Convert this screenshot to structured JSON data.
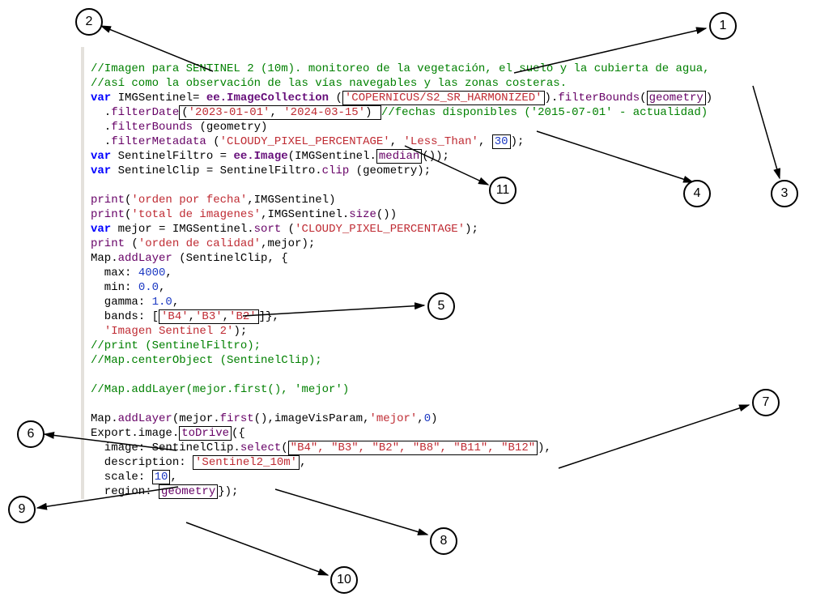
{
  "callouts": {
    "n1": "1",
    "n2": "2",
    "n3": "3",
    "n4": "4",
    "n5": "5",
    "n6": "6",
    "n7": "7",
    "n8": "8",
    "n9": "9",
    "n10": "10",
    "n11": "11"
  },
  "code": {
    "l1": "//Imagen para SENTINEL 2 (10m). monitoreo de la vegetación, el suelo y la cubierta de agua,",
    "l2": "//así como la observación de las vías navegables y las zonas costeras.",
    "l3_a": "var",
    "l3_b": " IMGSentinel= ",
    "l3_c": "ee.ImageCollection",
    "l3_d": " (",
    "l3_e": "'COPERNICUS/S2_SR_HARMONIZED'",
    "l3_f": ").",
    "l3_g": "filterBounds",
    "l3_h": "(",
    "l3_i": "geometry",
    "l3_j": ")",
    "l4_a": "  .",
    "l4_b": "filterDate",
    "l4_c": "(",
    "l4_d": "'2023-01-01'",
    "l4_e": ", ",
    "l4_f": "'2024-03-15'",
    "l4_g": ") ",
    "l4_h": "//fechas disponibles ('2015-07-01' - actualidad)",
    "l5_a": "  .",
    "l5_b": "filterBounds",
    "l5_c": " (geometry)",
    "l6_a": "  .",
    "l6_b": "filterMetadata",
    "l6_c": " (",
    "l6_d": "'CLOUDY_PIXEL_PERCENTAGE'",
    "l6_e": ", ",
    "l6_f": "'Less_Than'",
    "l6_g": ", ",
    "l6_h": "30",
    "l6_i": ");",
    "l7_a": "var",
    "l7_b": " SentinelFiltro = ",
    "l7_c": "ee.Image",
    "l7_d": "(IMGSentinel.",
    "l7_e": "median",
    "l7_f": "());",
    "l8_a": "var",
    "l8_b": " SentinelClip = SentinelFiltro.",
    "l8_c": "clip",
    "l8_d": " (geometry);",
    "l10_a": "print",
    "l10_b": "(",
    "l10_c": "'orden por fecha'",
    "l10_d": ",IMGSentinel)",
    "l11_a": "print",
    "l11_b": "(",
    "l11_c": "'total de imagenes'",
    "l11_d": ",IMGSentinel.",
    "l11_e": "size",
    "l11_f": "())",
    "l12_a": "var",
    "l12_b": " mejor = IMGSentinel.",
    "l12_c": "sort",
    "l12_d": " (",
    "l12_e": "'CLOUDY_PIXEL_PERCENTAGE'",
    "l12_f": ");",
    "l13_a": "print",
    "l13_b": " (",
    "l13_c": "'orden de calidad'",
    "l13_d": ",mejor);",
    "l14_a": "Map.",
    "l14_b": "addLayer",
    "l14_c": " (SentinelClip, {",
    "l15_a": "  max: ",
    "l15_b": "4000",
    "l15_c": ",",
    "l16_a": "  min: ",
    "l16_b": "0.0",
    "l16_c": ",",
    "l17_a": "  gamma: ",
    "l17_b": "1.0",
    "l17_c": ",",
    "l18_a": "  bands: [",
    "l18_b": "'B4'",
    "l18_c": ",",
    "l18_d": "'B3'",
    "l18_e": ",",
    "l18_f": "'B2'",
    "l18_g": "]},",
    "l19_a": "  ",
    "l19_b": "'Imagen Sentinel 2'",
    "l19_c": ");",
    "l20": "//print (SentinelFiltro);",
    "l21": "//Map.centerObject (SentinelClip);",
    "l23": "//Map.addLayer(mejor.first(), 'mejor')",
    "l25_a": "Map.",
    "l25_b": "addLayer",
    "l25_c": "(mejor.",
    "l25_d": "first",
    "l25_e": "(),imageVisParam,",
    "l25_f": "'mejor'",
    "l25_g": ",",
    "l25_h": "0",
    "l25_i": ")",
    "l26_a": "Export.image.",
    "l26_b": "toDrive",
    "l26_c": "({",
    "l27_a": "  image: SentinelClip.",
    "l27_b": "select",
    "l27_c": "(",
    "l27_d": "\"B4\", \"B3\", \"B2\", \"B8\", \"B11\", \"B12\"",
    "l27_e": "),",
    "l28_a": "  description: ",
    "l28_b": "'Sentinel2_10m'",
    "l28_c": ",",
    "l29_a": "  scale: ",
    "l29_b": "10",
    "l29_c": ",",
    "l30_a": "  region: ",
    "l30_b": "geometry",
    "l30_c": "});"
  }
}
